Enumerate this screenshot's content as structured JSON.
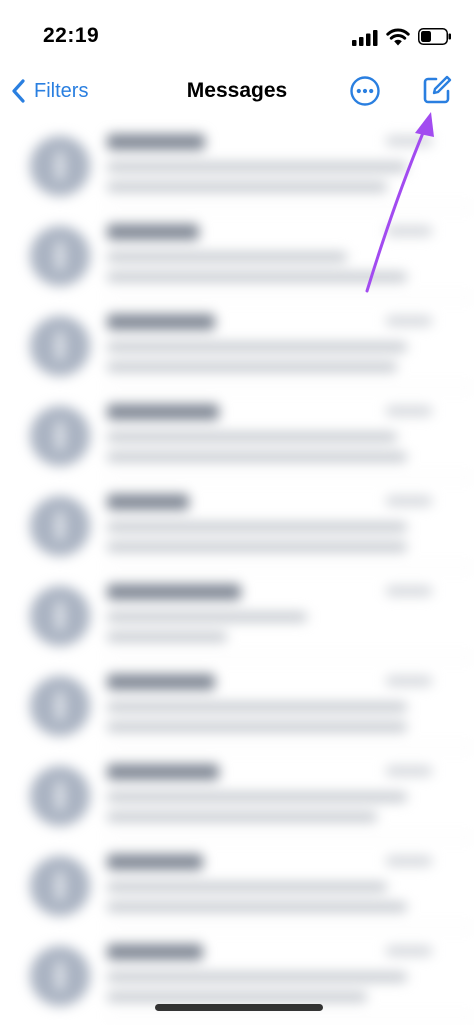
{
  "status_bar": {
    "time": "22:19",
    "icons": [
      "cellular-signal-icon",
      "wifi-icon",
      "battery-icon"
    ]
  },
  "nav_bar": {
    "back_label": "Filters",
    "title": "Messages",
    "back_icon": "chevron-left-icon",
    "more_icon": "ellipsis-circle-icon",
    "compose_icon": "compose-icon"
  },
  "colors": {
    "accent": "#2a7fe0",
    "annotation_arrow": "#a24bf0",
    "avatar": "#aab3c2"
  },
  "message_list": {
    "row_count": 10
  }
}
